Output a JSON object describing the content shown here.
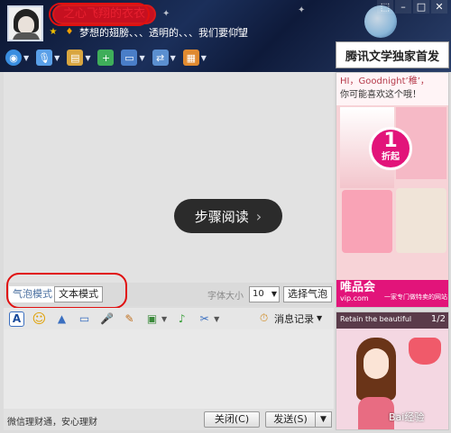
{
  "header": {
    "nickname": "之心飞翔的衣衣",
    "status": "梦想的翅膀、、、透明的、、、我们要仰望",
    "window_controls": [
      "⬚",
      "–",
      "□",
      "✕"
    ]
  },
  "toolbar": {
    "icons": [
      "video-call-icon",
      "voice-call-icon",
      "file-transfer-icon",
      "add-app-icon",
      "remote-desktop-icon",
      "screen-share-icon",
      "apps-grid-icon"
    ]
  },
  "ads": {
    "banner": "腾讯文学独家首发",
    "greeting_line1": "HI，Goodnight’稚’，",
    "greeting_line2": "你可能喜欢这个哦！",
    "badge_number": "1",
    "badge_text": "折起",
    "brand": "唯品会",
    "brand_url": "vip.com",
    "brand_slogan": "一家专门做特卖的网站",
    "ad2_tagline": "Retain the beautiful",
    "ad2_page": "1/2"
  },
  "chat": {
    "read_button": "步骤阅读"
  },
  "mode_bar": {
    "bubble_mode": "气泡模式",
    "text_mode": "文本模式",
    "font_size_label": "字体大小",
    "font_size_value": "10",
    "choose_bubble": "选择气泡"
  },
  "tools": {
    "history_label": "消息记录"
  },
  "bottom": {
    "text": "微信理财通，安心理财",
    "close": "关闭(C)",
    "send": "发送(S)"
  }
}
